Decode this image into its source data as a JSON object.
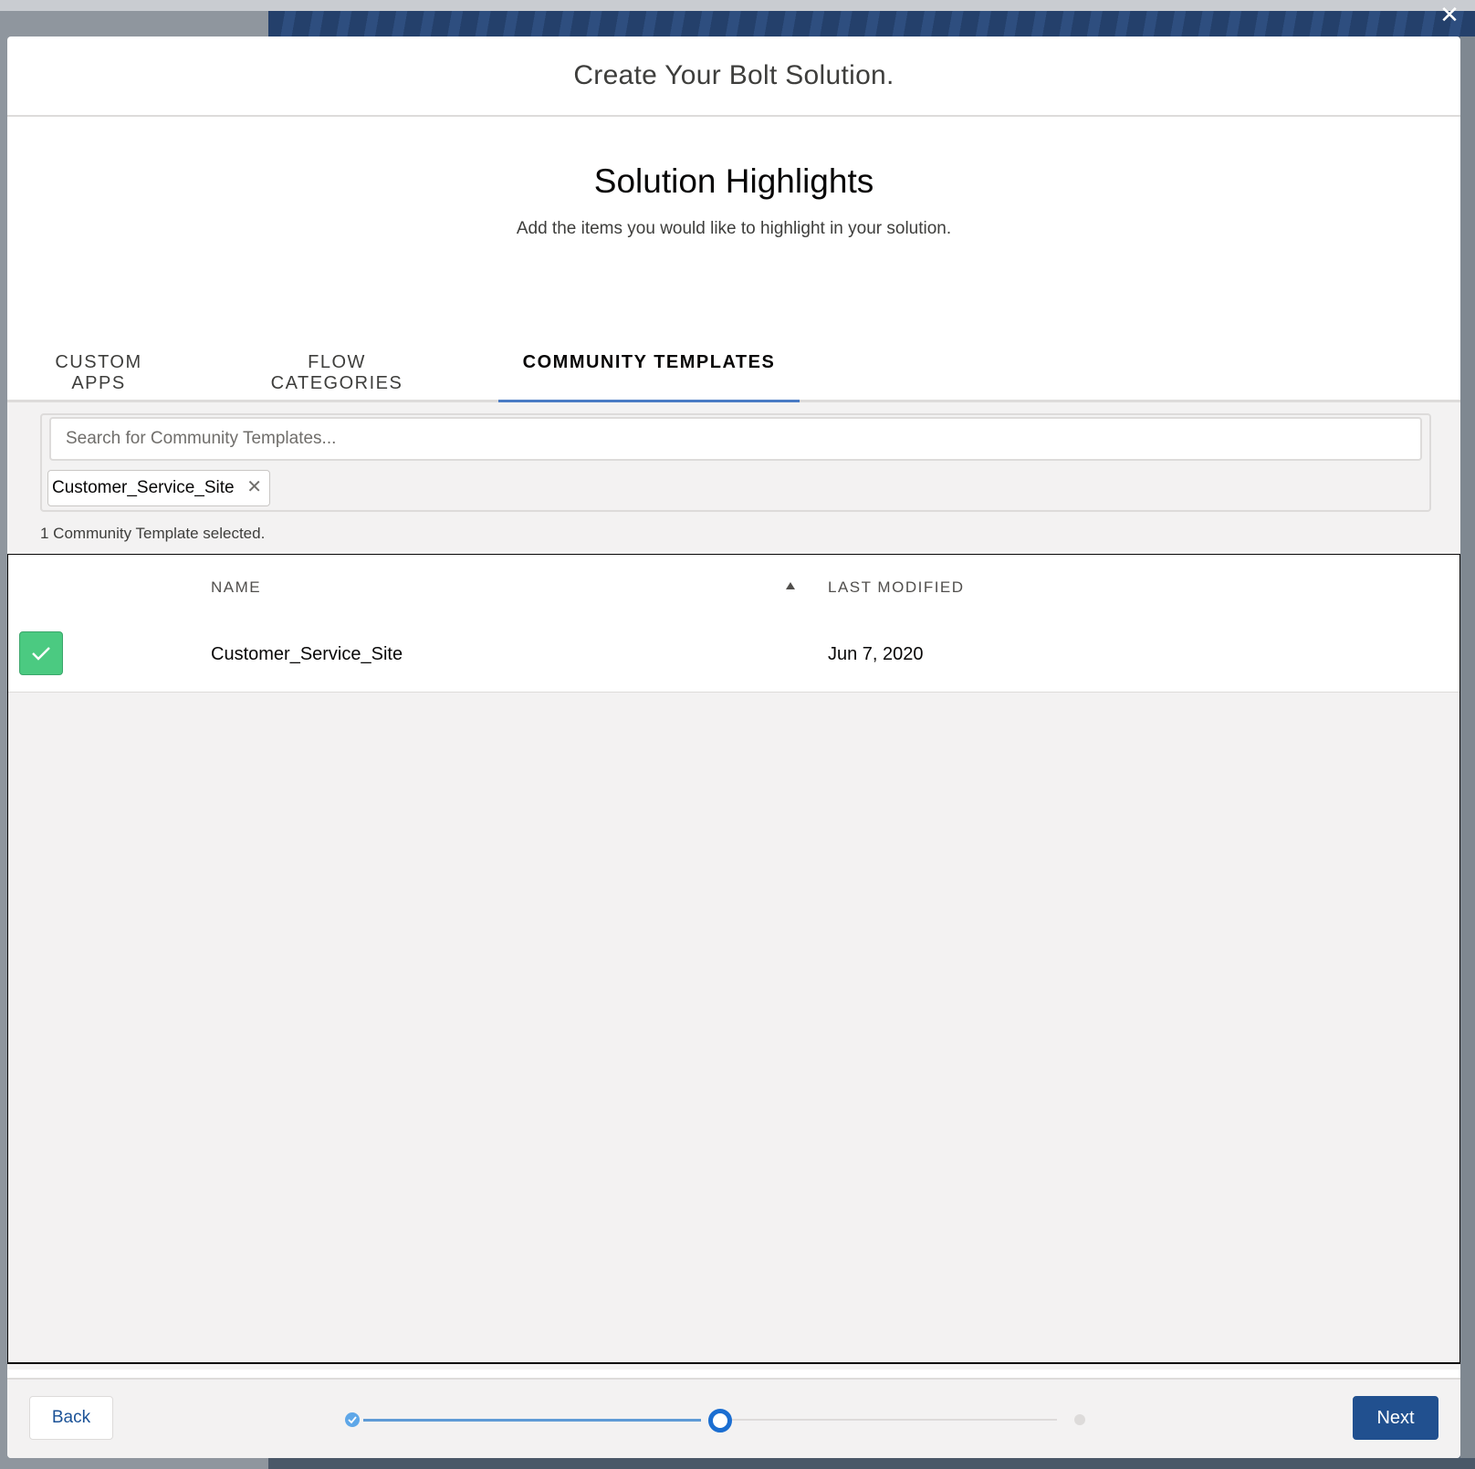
{
  "modal": {
    "title": "Create Your Bolt Solution.",
    "close_icon": "close-icon"
  },
  "hero": {
    "title": "Solution Highlights",
    "subtitle": "Add the items you would like to highlight in your solution."
  },
  "tabs": [
    {
      "label": "CUSTOM APPS",
      "active": false
    },
    {
      "label": "FLOW CATEGORIES",
      "active": false
    },
    {
      "label": "COMMUNITY TEMPLATES",
      "active": true
    }
  ],
  "search": {
    "placeholder": "Search for Community Templates...",
    "value": ""
  },
  "selected_pill": {
    "label": "Customer_Service_Site"
  },
  "selection_count": "1 Community Template selected.",
  "table": {
    "columns": [
      "NAME",
      "LAST MODIFIED"
    ],
    "sort": "ascending",
    "rows": [
      {
        "name": "Customer_Service_Site",
        "last_modified": "Jun 7, 2020",
        "selected": true
      }
    ]
  },
  "footer": {
    "back_label": "Back",
    "next_label": "Next",
    "progress_steps": 3,
    "current_step": 2
  },
  "colors": {
    "accent": "#21508f",
    "selected_check": "#4bca81",
    "tab_indicator": "#4a7bc4"
  }
}
